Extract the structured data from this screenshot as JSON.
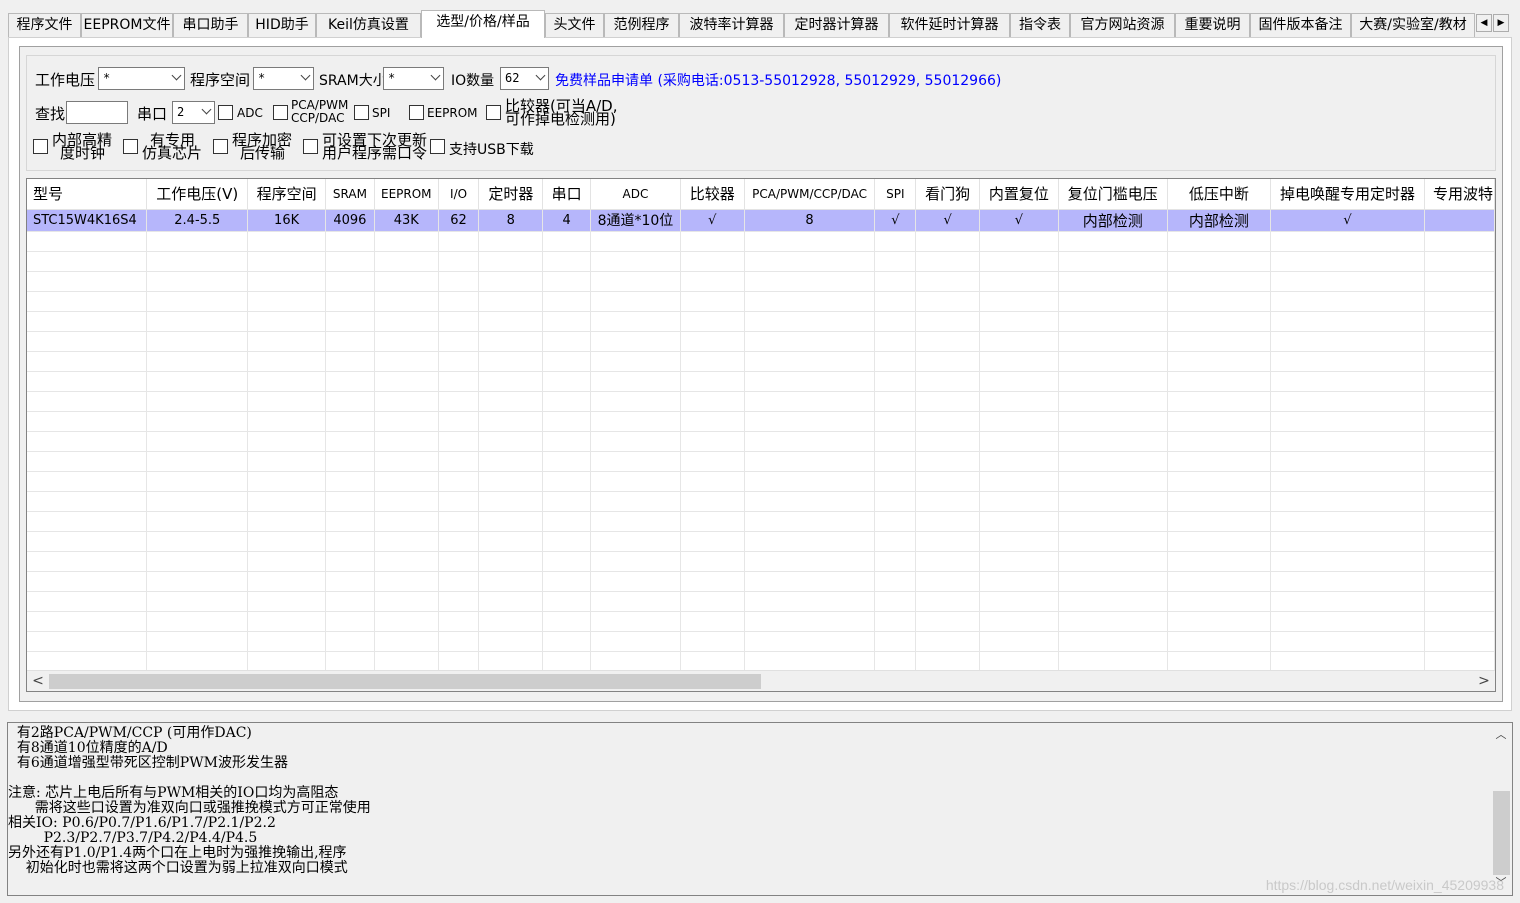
{
  "tabs": [
    {
      "label": "程序文件",
      "active": false
    },
    {
      "label": "EEPROM文件",
      "active": false
    },
    {
      "label": "串口助手",
      "active": false
    },
    {
      "label": "HID助手",
      "active": false
    },
    {
      "label": "Keil仿真设置",
      "active": false
    },
    {
      "label": "选型/价格/样品",
      "active": true
    },
    {
      "label": "头文件",
      "active": false
    },
    {
      "label": "范例程序",
      "active": false
    },
    {
      "label": "波特率计算器",
      "active": false
    },
    {
      "label": "定时器计算器",
      "active": false
    },
    {
      "label": "软件延时计算器",
      "active": false
    },
    {
      "label": "指令表",
      "active": false
    },
    {
      "label": "官方网站资源",
      "active": false
    },
    {
      "label": "重要说明",
      "active": false
    },
    {
      "label": "固件版本备注",
      "active": false
    },
    {
      "label": "大赛/实验室/教材",
      "active": false
    }
  ],
  "tab_scroll": {
    "left": "◀",
    "right": "▶"
  },
  "filters": {
    "voltage_label": "工作电压",
    "voltage_value": "*",
    "flash_label": "程序空间",
    "flash_value": "*",
    "sram_label": "SRAM大小",
    "sram_value": "*",
    "io_label": "IO数量",
    "io_value": "62",
    "sample_link": "免费样品申请单 (采购电话:0513-55012928, 55012929, 55012966)",
    "search_label": "查找",
    "search_value": "",
    "uart_label": "串口",
    "uart_value": "2",
    "chk_adc": "ADC",
    "chk_pca_1": "PCA/PWM",
    "chk_pca_2": "CCP/DAC",
    "chk_spi": "SPI",
    "chk_eeprom": "EEPROM",
    "chk_cmp_1": "比较器(可当A/D,",
    "chk_cmp_2": "可作掉电检测用)",
    "chk_irc_1": "内部高精",
    "chk_irc_2": "度时钟",
    "chk_ice_1": "有专用",
    "chk_ice_2": "仿真芯片",
    "chk_enc_1": "程序加密",
    "chk_enc_2": "后传输",
    "chk_upd_1": "可设置下次更新",
    "chk_upd_2": "用户程序需口令",
    "chk_usb": "支持USB下载"
  },
  "table": {
    "headers": [
      "型号",
      "工作电压(V)",
      "程序空间",
      "SRAM",
      "EEPROM",
      "I/O",
      "定时器",
      "串口",
      "ADC",
      "比较器",
      "PCA/PWM/CCP/DAC",
      "SPI",
      "看门狗",
      "内置复位",
      "复位门槛电压",
      "低压中断",
      "掉电唤醒专用定时器",
      "专用波特"
    ],
    "rows": [
      [
        "STC15W4K16S4",
        "2.4-5.5",
        "16K",
        "4096",
        "43K",
        "62",
        "8",
        "4",
        "8通道*10位",
        "√",
        "8",
        "√",
        "√",
        "√",
        "内部检测",
        "内部检测",
        "√",
        ""
      ]
    ],
    "scroll_left": "<",
    "scroll_right": ">"
  },
  "description": {
    "lines": [
      "  有2路PCA/PWM/CCP (可用作DAC)",
      "  有8通道10位精度的A/D",
      "  有6通道增强型带死区控制PWM波形发生器",
      "",
      "注意: 芯片上电后所有与PWM相关的IO口均为高阻态",
      "      需将这些口设置为准双向口或强推挽模式方可正常使用",
      "相关IO: P0.6/P0.7/P1.6/P1.7/P2.1/P2.2",
      "        P2.3/P2.7/P3.7/P4.2/P4.4/P4.5",
      "另外还有P1.0/P1.4两个口在上电时为强推挽输出,程序",
      "    初始化时也需将这两个口设置为弱上拉准双向口模式"
    ],
    "watermark": "https://blog.csdn.net/weixin_45209938"
  }
}
